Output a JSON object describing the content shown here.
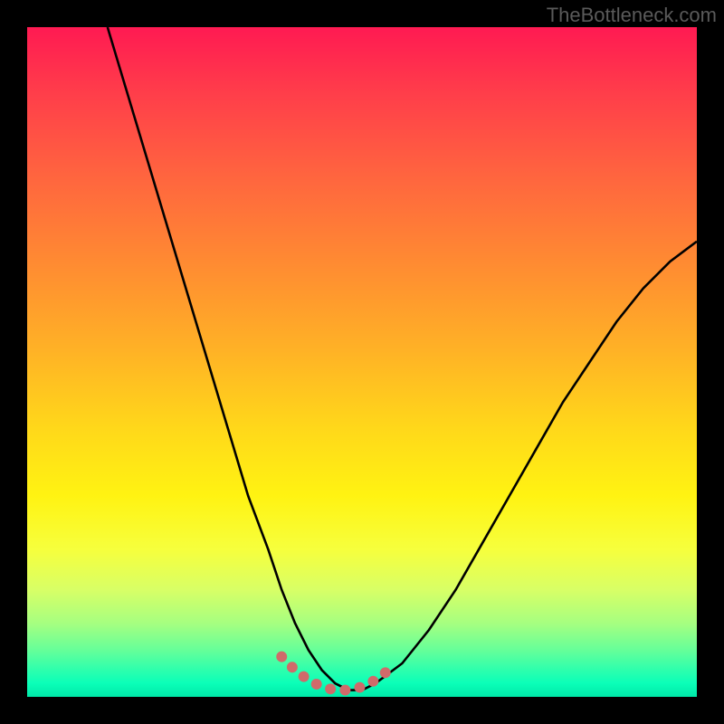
{
  "watermark": "TheBottleneck.com",
  "chart_data": {
    "type": "line",
    "title": "",
    "xlabel": "",
    "ylabel": "",
    "xlim": [
      0,
      100
    ],
    "ylim": [
      0,
      100
    ],
    "grid": false,
    "legend": false,
    "series": [
      {
        "name": "main-curve",
        "x": [
          12,
          15,
          18,
          21,
          24,
          27,
          30,
          33,
          36,
          38,
          40,
          42,
          44,
          46,
          48,
          50,
          52,
          56,
          60,
          64,
          68,
          72,
          76,
          80,
          84,
          88,
          92,
          96,
          100
        ],
        "y": [
          100,
          90,
          80,
          70,
          60,
          50,
          40,
          30,
          22,
          16,
          11,
          7,
          4,
          2,
          1,
          1,
          2,
          5,
          10,
          16,
          23,
          30,
          37,
          44,
          50,
          56,
          61,
          65,
          68
        ]
      },
      {
        "name": "valley-highlight",
        "x": [
          38,
          40,
          42,
          44,
          46,
          48,
          50,
          52,
          54
        ],
        "y": [
          6,
          4,
          2.5,
          1.5,
          1,
          1,
          1.5,
          2.5,
          4
        ]
      }
    ],
    "gradient": {
      "stops": [
        {
          "pos": 0.0,
          "color": "#ff1a52"
        },
        {
          "pos": 0.1,
          "color": "#ff3e4a"
        },
        {
          "pos": 0.22,
          "color": "#ff643f"
        },
        {
          "pos": 0.35,
          "color": "#ff8a32"
        },
        {
          "pos": 0.48,
          "color": "#ffb126"
        },
        {
          "pos": 0.6,
          "color": "#ffd81a"
        },
        {
          "pos": 0.7,
          "color": "#fff312"
        },
        {
          "pos": 0.78,
          "color": "#f6ff3d"
        },
        {
          "pos": 0.84,
          "color": "#d8ff66"
        },
        {
          "pos": 0.89,
          "color": "#a6ff80"
        },
        {
          "pos": 0.93,
          "color": "#66ff99"
        },
        {
          "pos": 0.96,
          "color": "#2dffad"
        },
        {
          "pos": 0.98,
          "color": "#0affb8"
        },
        {
          "pos": 1.0,
          "color": "#00e8a8"
        }
      ]
    },
    "colors": {
      "curve": "#000000",
      "highlight": "#d06a6a",
      "background_frame": "#000000"
    }
  }
}
